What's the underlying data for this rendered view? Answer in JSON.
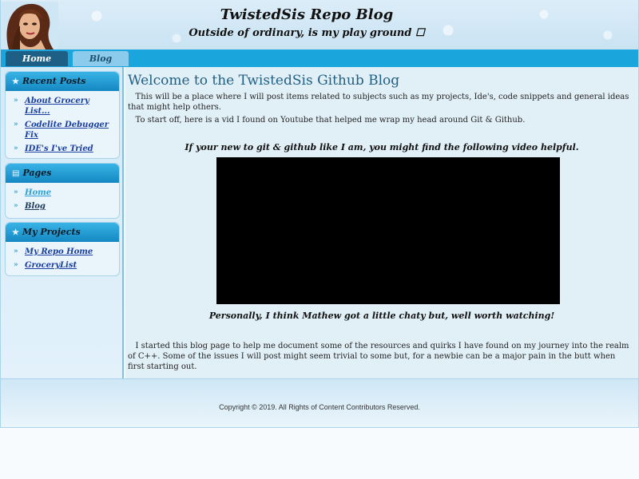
{
  "header": {
    "title": "TwistedSis Repo Blog",
    "tagline": "Outside of ordinary, is my play ground ☐"
  },
  "nav": {
    "tabs": [
      {
        "label": "Home",
        "active": true
      },
      {
        "label": "Blog",
        "active": false
      }
    ]
  },
  "sidebar": {
    "recent_posts": {
      "title": "Recent Posts",
      "icon": "star-icon",
      "items": [
        "About Grocery List...",
        "Codelite Debugger Fix",
        "IDE's I've Tried"
      ]
    },
    "pages": {
      "title": "Pages",
      "icon": "square-icon",
      "items": [
        "Home",
        "Blog"
      ]
    },
    "projects": {
      "title": "My Projects",
      "icon": "star-icon",
      "items": [
        "My Repo Home",
        "GroceryList"
      ]
    }
  },
  "main": {
    "title": "Welcome to the TwistedSis Github Blog",
    "intro": "This will be a place where I will post items related to subjects such as my projects, Ide's, code snippets and general ideas that might help others.",
    "start": "To start off, here is a vid I found on Youtube that helped me wrap my head around Git & Github.",
    "video_caption": "If your new to git & github like I am, you might find the following video helpful.",
    "opinion": "Personally, I think Mathew got a little chaty but, well worth watching!",
    "closing": "I started this blog page to help me document some of the resources and quirks I have found on my journey into the realm of C++. Some of the issues I will post might seem trivial to some but, for a newbie can be a major pain in the butt when first starting out."
  },
  "footer": {
    "copyright": "Copyright © 2019. All Rights of Content Contributors Reserved."
  },
  "colors": {
    "nav_bar": "#1aa5dd",
    "active_tab": "#1d5f85",
    "title_blue": "#1f5f84",
    "link_blue": "#1a3fa0"
  }
}
